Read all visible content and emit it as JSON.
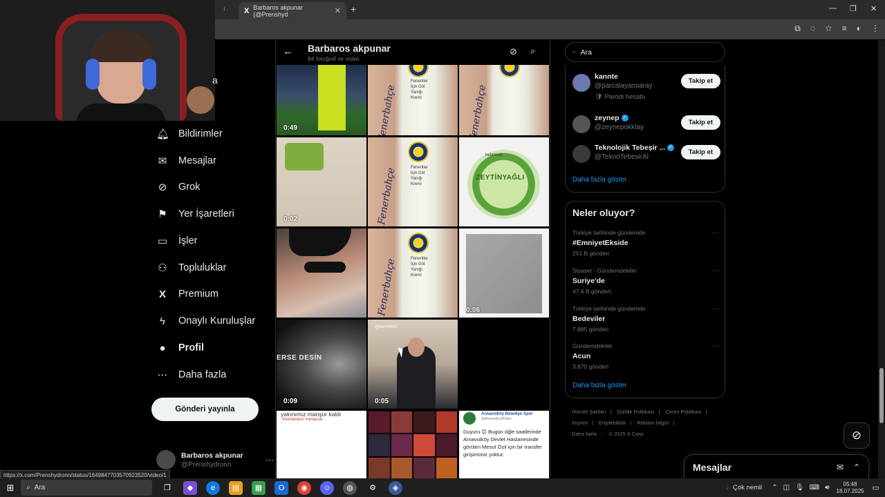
{
  "browser": {
    "tab_ghost": "ı",
    "tab_title": "Barbaros akpunar (@Prenshyd",
    "tab_x_logo": "X",
    "tab_close": "✕",
    "new_tab": "+",
    "win_min": "—",
    "win_max": "❐",
    "win_close": "✕"
  },
  "webcam": {},
  "nav": {
    "partial_label": "a",
    "items": [
      {
        "label": "Bildirimler",
        "icon": "bell-icon",
        "glyph": "🔔︎"
      },
      {
        "label": "Mesajlar",
        "icon": "mail-icon",
        "glyph": "✉"
      },
      {
        "label": "Grok",
        "icon": "grok-icon",
        "glyph": "⊘"
      },
      {
        "label": "Yer İşaretleri",
        "icon": "bookmark-icon",
        "glyph": "⚑"
      },
      {
        "label": "İşler",
        "icon": "briefcase-icon",
        "glyph": "▭"
      },
      {
        "label": "Topluluklar",
        "icon": "people-icon",
        "glyph": "⚇"
      },
      {
        "label": "Premium",
        "icon": "x-logo-icon",
        "glyph": "X"
      },
      {
        "label": "Onaylı Kuruluşlar",
        "icon": "lightning-icon",
        "glyph": "ϟ"
      },
      {
        "label": "Profil",
        "icon": "person-icon",
        "glyph": "●"
      },
      {
        "label": "Daha fazla",
        "icon": "more-circle-icon",
        "glyph": "⋯"
      }
    ],
    "post_button": "Gönderi yayınla",
    "account": {
      "name": "Barbaros akpunar",
      "handle": "@Prenshydronn",
      "more": "···"
    }
  },
  "status_url": "https://x.com/Prenshydronn/status/1649847703570923520/video/1",
  "main": {
    "title": "Barbaros akpunar",
    "subtitle": "84 fotoğraf ve video",
    "back": "←",
    "grok": "⊘",
    "search": "⌕",
    "tiles": [
      {
        "duration": "0:49"
      },
      {
        "duration": ""
      },
      {
        "duration": ""
      },
      {
        "duration": "0:02"
      },
      {
        "duration": ""
      },
      {
        "duration": ""
      },
      {
        "duration": ""
      },
      {
        "duration": ""
      },
      {
        "duration": "0:06"
      },
      {
        "duration": "0:09"
      },
      {
        "duration": "0:05"
      }
    ],
    "cream_word": "Fenerbahçe",
    "cream_label": "Fenerliler\nİçin Göt\nYanığı\nKremi",
    "zeytin_brand": "hebmictic",
    "zeytin_text": "ZEYTİNYAĞLI",
    "bw_text": "ERSE DESİN",
    "suit_wm": "@ilan14mm",
    "white_text_1": "yakınımız manşur kaldı",
    "white_text_2": "#numaranız #umarcar",
    "notice_org": "Arnavutköy Belediye Spor",
    "notice_handle": "@ArnavutkoyBSpor",
    "notice_body": "Duyuru 😊 Bugün öğle saatlerinde Arnavutköy Devlet Hastanesinde görülen Mesut Özil için bir transfer girişimimiz yoktur."
  },
  "sidebar": {
    "search_placeholder": "Ara",
    "who": [
      {
        "name": "kannte",
        "handle": "@parcalayansaray",
        "extra": "🛡 Parodi hesabı",
        "button": "Takip et",
        "verified": false
      },
      {
        "name": "zeynep",
        "handle": "@zeynepokktay",
        "extra": "",
        "button": "Takip et",
        "verified": true
      },
      {
        "name": "Teknolojik Tebeşir ...",
        "handle": "@TeknoTebesirAl",
        "extra": "",
        "button": "Takip et",
        "verified": true
      }
    ],
    "who_more": "Daha fazla göster",
    "trends_title": "Neler oluyor?",
    "trends": [
      {
        "category": "Türkiye tarihinde gündemde",
        "name": "#EmniyetEkside",
        "count": "251 B gönderi"
      },
      {
        "category": "Siyaset · Gündemdekiler",
        "name": "Suriye'de",
        "count": "47,4 B gönderi"
      },
      {
        "category": "Türkiye tarihinde gündemde",
        "name": "Bedeviler",
        "count": "7.885 gönderi"
      },
      {
        "category": "Gündemdekiler",
        "name": "Acun",
        "count": "3.870 gönderi"
      }
    ],
    "trends_more": "Daha fazla göster",
    "footer": [
      "Hizmet Şartları",
      "|",
      "Gizlilik Politikası",
      "|",
      "Çerez Politikası",
      "|",
      "Imprint",
      "|",
      "Erişilebilirlik",
      "|",
      "Reklam bilgisi",
      "|",
      "Daha fazla ···",
      "© 2025 X Corp."
    ]
  },
  "messages_drawer": {
    "title": "Mesajlar",
    "compose": "✉",
    "collapse": "⌃"
  },
  "taskbar": {
    "start": "⊞",
    "search": "Ara",
    "weather": "Çok nemli",
    "time": "05:48",
    "date": "18.07.2025"
  },
  "colors": {
    "accent": "#1d9bf0",
    "background": "#000000",
    "text": "#e7e9ea",
    "muted": "#71767b"
  }
}
